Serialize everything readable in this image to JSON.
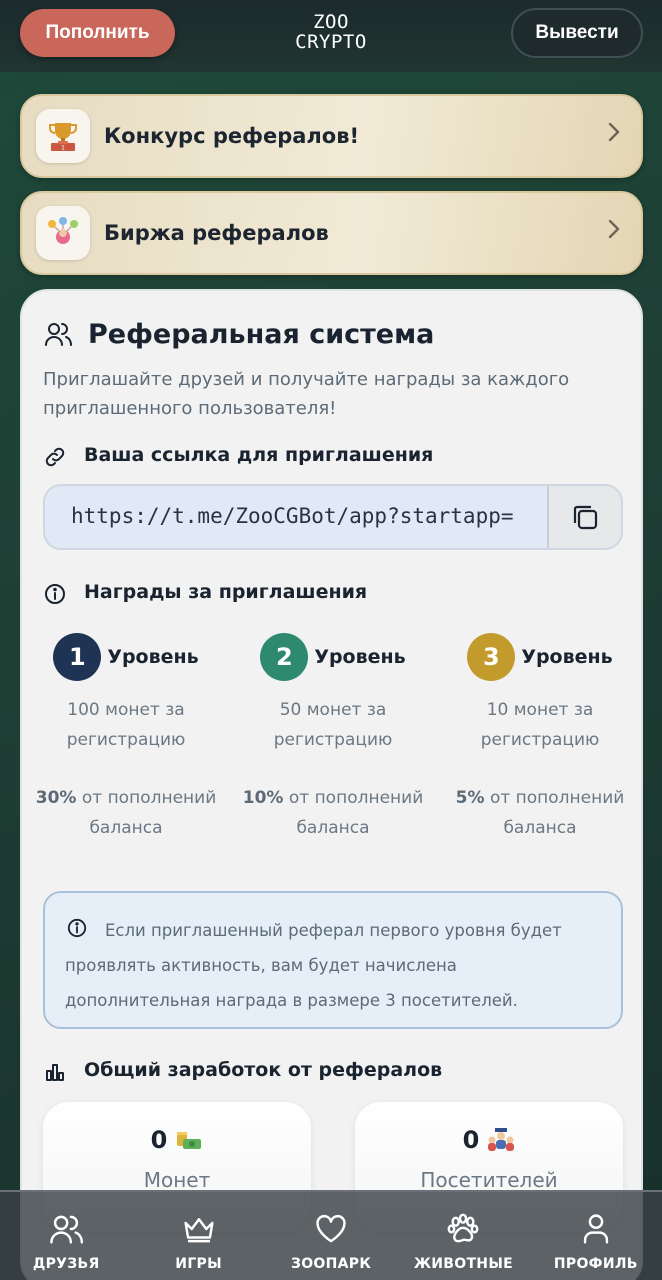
{
  "header": {
    "deposit_label": "Пополнить",
    "logo_line1": "ZOO",
    "logo_line2": "CRYPTO",
    "withdraw_label": "Вывести"
  },
  "banners": [
    {
      "label": "Конкурс рефералов!",
      "icon": "trophy-icon"
    },
    {
      "label": "Биржа рефералов",
      "icon": "referral-exchange-icon"
    }
  ],
  "referral": {
    "title": "Реферальная система",
    "subtitle": "Приглашайте друзей и получайте награды за каждого приглашенного пользователя!",
    "link_heading": "Ваша ссылка для приглашения",
    "link_value": "https://t.me/ZooCGBot/app?startapp=",
    "rewards_heading": "Награды за приглашения",
    "levels": [
      {
        "num": "1",
        "name": "Уровень",
        "reg": "100 монет за регистрацию",
        "pct": "30%",
        "pct_text": "от пополнений баланса",
        "color": "#1f3454"
      },
      {
        "num": "2",
        "name": "Уровень",
        "reg": "50 монет за регистрацию",
        "pct": "10%",
        "pct_text": "от пополнений баланса",
        "color": "#2e8a6e"
      },
      {
        "num": "3",
        "name": "Уровень",
        "reg": "10 монет за регистрацию",
        "pct": "5%",
        "pct_text": "от пополнений баланса",
        "color": "#c39a2c"
      }
    ],
    "info_text": "Если приглашенный реферал первого уровня будет проявлять активность, вам будет начислена дополнительная награда в размере 3 посетителей.",
    "earnings_heading": "Общий заработок от рефералов",
    "earnings": [
      {
        "value": "0",
        "label": "Монет",
        "icon": "coins-icon"
      },
      {
        "value": "0",
        "label": "Посетителей",
        "icon": "visitors-icon"
      }
    ]
  },
  "nav": [
    {
      "label": "ДРУЗЬЯ",
      "icon": "friends-icon",
      "active": true
    },
    {
      "label": "ИГРЫ",
      "icon": "crown-icon",
      "active": false
    },
    {
      "label": "ЗООПАРК",
      "icon": "heart-icon",
      "active": false
    },
    {
      "label": "ЖИВОТНЫЕ",
      "icon": "paw-icon",
      "active": false
    },
    {
      "label": "ПРОФИЛЬ",
      "icon": "profile-icon",
      "active": false
    }
  ],
  "colors": {
    "accent_deposit": "#c9675a",
    "level1": "#1f3454",
    "level2": "#2e8a6e",
    "level3": "#c39a2c"
  }
}
